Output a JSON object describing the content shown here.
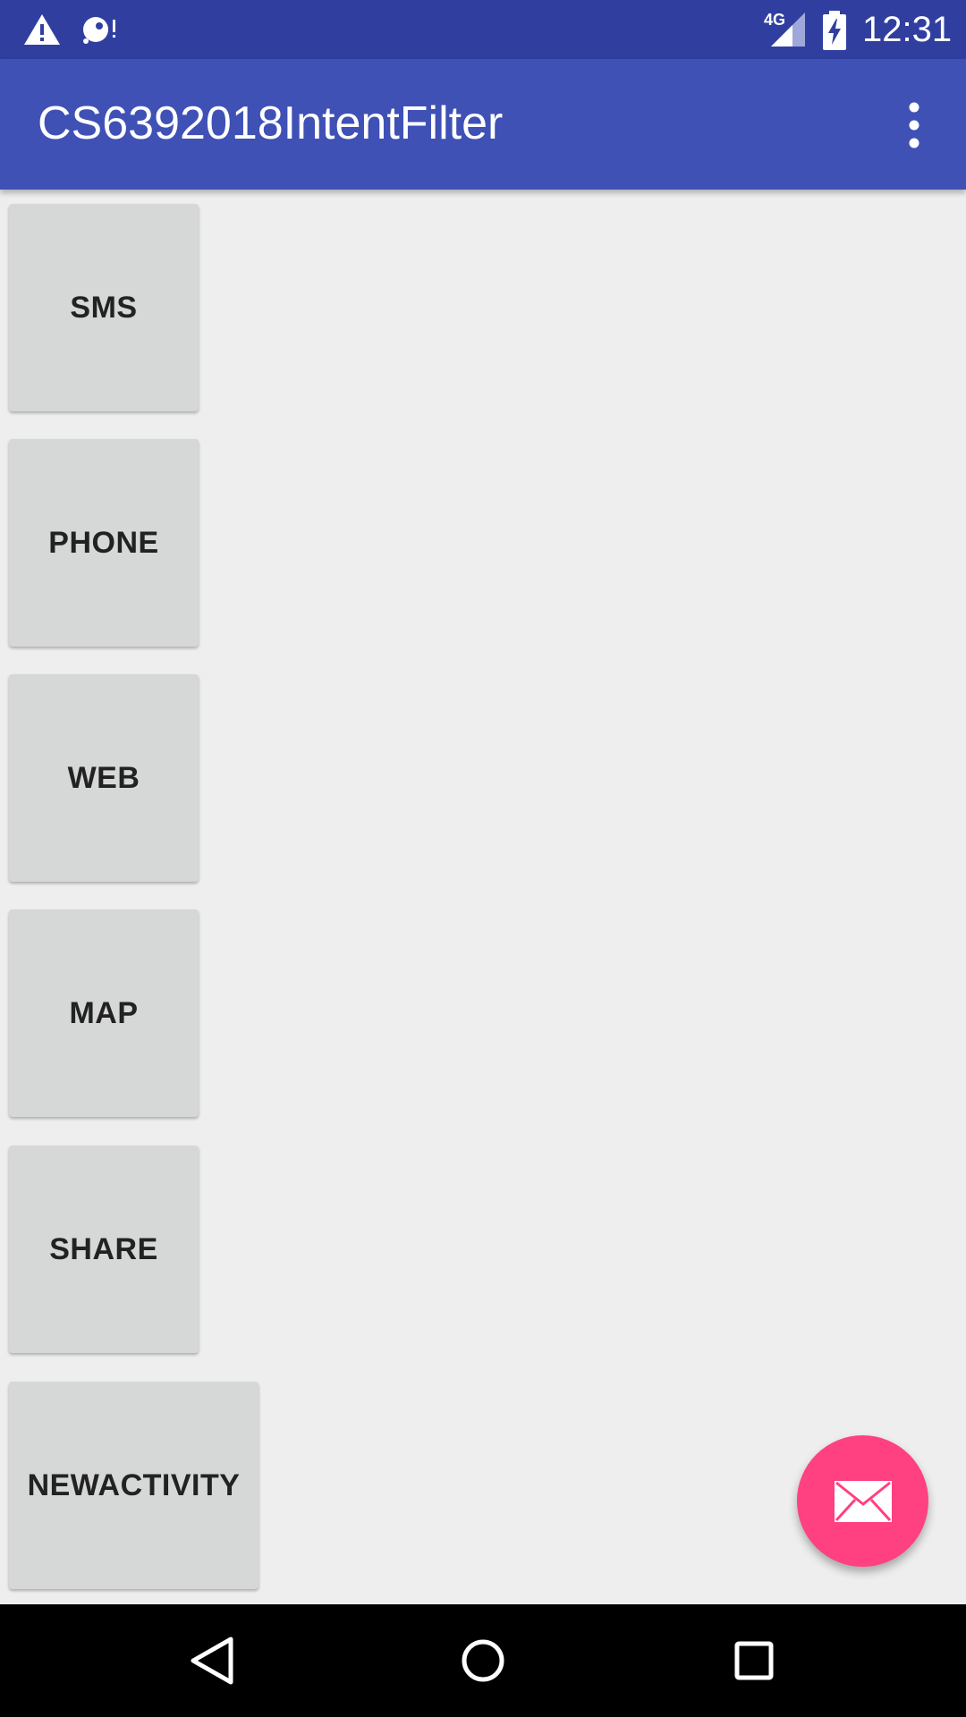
{
  "status_bar": {
    "network_type": "4G",
    "time": "12:31",
    "icons": [
      "warning-icon",
      "disk-alert-icon",
      "cell-signal-icon",
      "battery-charging-icon"
    ],
    "background_color": "#303f9f"
  },
  "toolbar": {
    "title": "CS6392018IntentFilter",
    "overflow_icon": "more-vert-icon",
    "background_color": "#3f51b5"
  },
  "buttons": [
    {
      "label": "SMS"
    },
    {
      "label": "PHONE"
    },
    {
      "label": "WEB"
    },
    {
      "label": "MAP"
    },
    {
      "label": "SHARE"
    },
    {
      "label": "NEWACTIVITY"
    }
  ],
  "fab": {
    "icon": "email-icon",
    "color": "#ff4081"
  },
  "nav_bar": {
    "items": [
      "back-icon",
      "home-icon",
      "recents-icon"
    ]
  }
}
